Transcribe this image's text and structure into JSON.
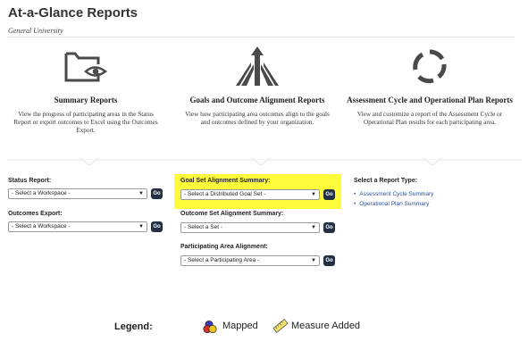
{
  "header": {
    "title": "At-a-Glance Reports",
    "subtitle": "General University"
  },
  "columns": [
    {
      "icon": "folder-eye-icon",
      "title": "Summary Reports",
      "description": "View the progress of participating areas in the Status Report or export outcomes to Excel using the Outcomes Export."
    },
    {
      "icon": "converging-arrows-icon",
      "title": "Goals and Outcome Alignment Reports",
      "description": "View how participating area outcomes align to the goals and outcomes defined by your organization."
    },
    {
      "icon": "cycle-icon",
      "title": "Assessment Cycle and Operational Plan Reports",
      "description": "View and customize a report of the Assessment Cycle or Operational Plan results for each participating area."
    }
  ],
  "summary": {
    "status_label": "Status Report:",
    "status_select": "- Select a Workspace -",
    "export_label": "Outcomes Export:",
    "export_select": "- Select a Workspace -"
  },
  "alignment": {
    "goal_label": "Goal Set Alignment Summary:",
    "goal_select": "- Select a Distributed Goal Set -",
    "outcome_label": "Outcome Set Alignment Summary:",
    "outcome_select": "- Select a Set -",
    "area_label": "Participating Area Alignment:",
    "area_select": "- Select a Participating Area -"
  },
  "cycle": {
    "type_label": "Select a Report Type:",
    "links": [
      "Assessment Cycle Summary",
      "Operational Plan Summary"
    ]
  },
  "go_label": "Go",
  "legend": {
    "label": "Legend:",
    "mapped": "Mapped",
    "measure_added": "Measure Added"
  },
  "colors": {
    "highlight": "#fdfb3a",
    "go_button": "#233044",
    "link": "#2a50a0"
  }
}
